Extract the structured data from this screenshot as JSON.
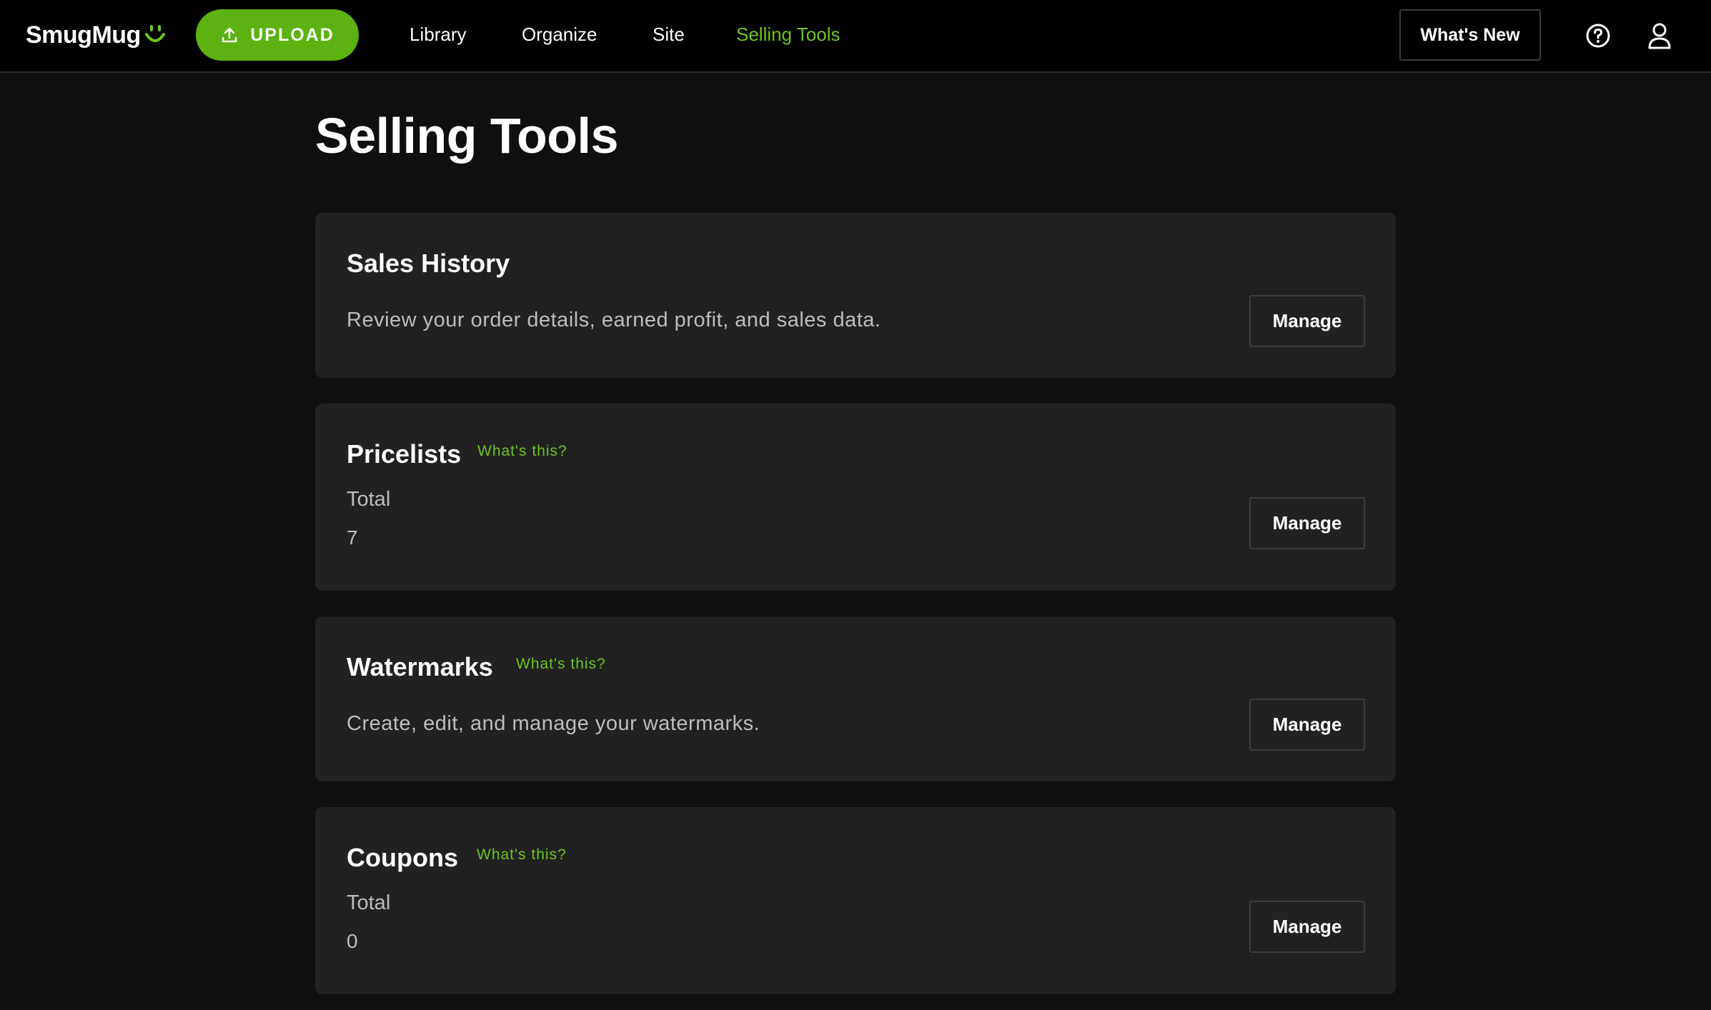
{
  "header": {
    "logo_text": "SmugMug",
    "upload_label": "UPLOAD",
    "nav": [
      {
        "label": "Library",
        "active": false
      },
      {
        "label": "Organize",
        "active": false
      },
      {
        "label": "Site",
        "active": false
      },
      {
        "label": "Selling Tools",
        "active": true
      }
    ],
    "whats_new_label": "What's New",
    "icons": [
      "upload-icon",
      "help-icon",
      "account-icon"
    ]
  },
  "page": {
    "title": "Selling Tools"
  },
  "cards": {
    "sales_history": {
      "title": "Sales History",
      "description": "Review your order details, earned profit, and sales data.",
      "button": "Manage"
    },
    "pricelists": {
      "title": "Pricelists",
      "help_link": "What's this?",
      "stat_label": "Total",
      "stat_value": "7",
      "button": "Manage"
    },
    "watermarks": {
      "title": "Watermarks",
      "help_link": "What's this?",
      "description": "Create, edit, and manage your watermarks.",
      "button": "Manage"
    },
    "coupons": {
      "title": "Coupons",
      "help_link": "What's this?",
      "stat_label": "Total",
      "stat_value": "0",
      "button": "Manage"
    }
  },
  "colors": {
    "accent": "#6cc51c",
    "upload_bg": "#5bb211",
    "page_bg": "#0f0f0f",
    "card_bg": "#212121",
    "topbar_bg": "#000000"
  }
}
